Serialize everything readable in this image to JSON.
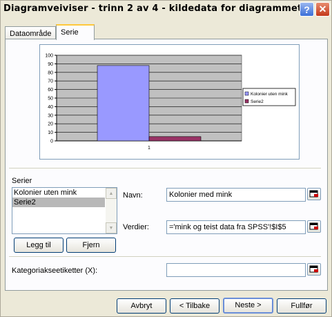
{
  "window": {
    "title": "Diagramveiviser - trinn 2 av 4 - kildedata for diagrammet"
  },
  "titlebar": {
    "help_label": "?",
    "close_label": "✕"
  },
  "tabs": [
    {
      "label": "Dataområde",
      "active": false
    },
    {
      "label": "Serie",
      "active": true
    }
  ],
  "chart_data": {
    "type": "bar",
    "categories": [
      "1"
    ],
    "series": [
      {
        "name": "Kolonier uten mink",
        "values": [
          88
        ],
        "color": "#9999FF"
      },
      {
        "name": "Serie2",
        "values": [
          5
        ],
        "color": "#993366"
      }
    ],
    "ylim": [
      0,
      100
    ],
    "yticks": [
      0,
      10,
      20,
      30,
      40,
      50,
      60,
      70,
      80,
      90,
      100
    ],
    "grid": true,
    "plot_background": "#C0C0C0",
    "legend": "right"
  },
  "series_section": {
    "label": "Serier",
    "items": [
      "Kolonier uten mink",
      "Serie2"
    ],
    "selected_index": 1,
    "add_label": "Legg til",
    "remove_label": "Fjern"
  },
  "name_field": {
    "label": "Navn:",
    "value": "Kolonier med mink"
  },
  "values_field": {
    "label": "Verdier:",
    "value": "='mink og teist data fra SPSS'!$I$5"
  },
  "category_field": {
    "label": "Kategoriakseetiketter (X):",
    "value": ""
  },
  "buttons": {
    "cancel": "Avbryt",
    "back": "< Tilbake",
    "next": "Neste >",
    "finish": "Fullfør"
  }
}
